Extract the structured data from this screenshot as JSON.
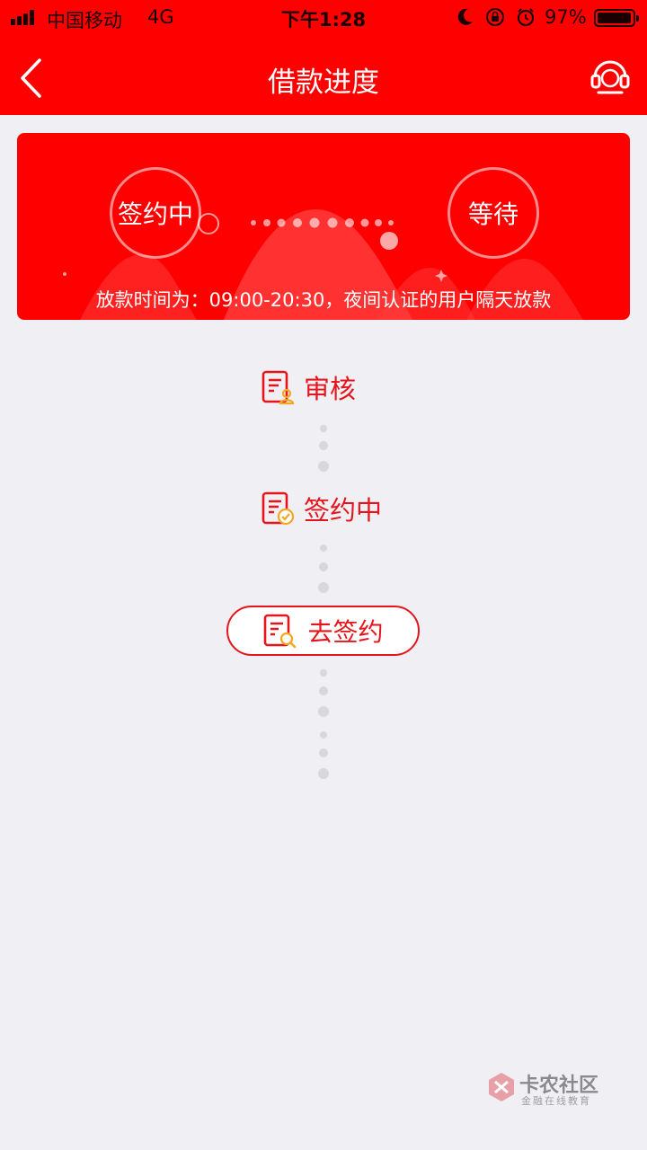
{
  "status_bar": {
    "carrier": "中国移动",
    "network": "4G",
    "time": "下午1:28",
    "battery": "97%"
  },
  "nav": {
    "title": "借款进度"
  },
  "banner": {
    "current_step": "签约中",
    "next_step": "等待",
    "note": "放款时间为：09:00-20:30，夜间认证的用户隔天放款"
  },
  "steps": [
    {
      "label": "审核"
    },
    {
      "label": "签约中"
    }
  ],
  "action": {
    "label": "去签约"
  },
  "watermark": {
    "title": "卡农社区",
    "subtitle": "金融在线教育"
  },
  "colors": {
    "brand_red": "#ff0000",
    "step_red": "#e5151b",
    "accent_orange": "#f5a623"
  }
}
